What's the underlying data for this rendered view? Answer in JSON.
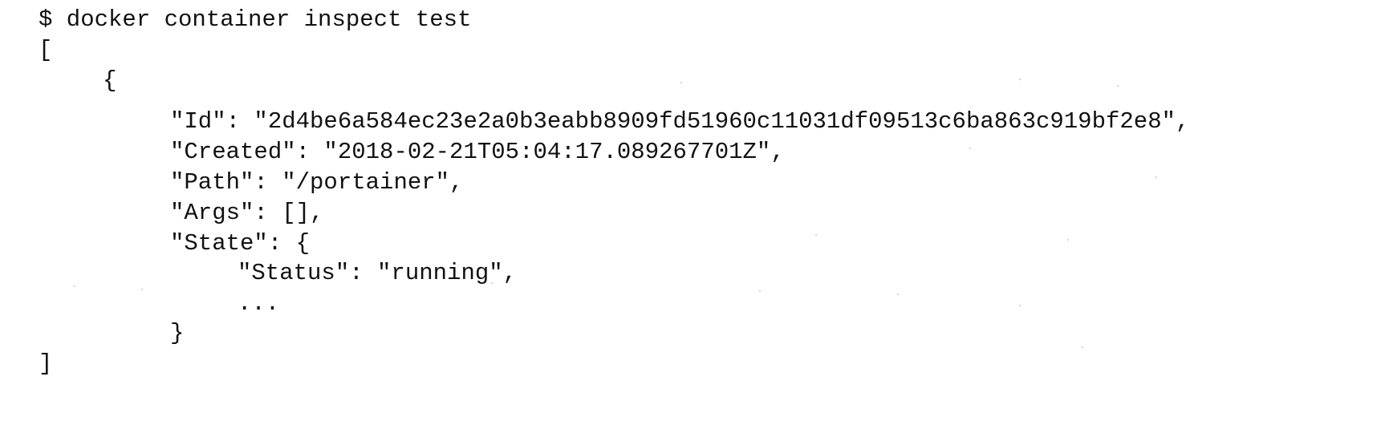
{
  "terminal": {
    "lines": [
      "$ docker container inspect test",
      "[",
      "{",
      "\"Id\": \"2d4be6a584ec23e2a0b3eabb8909fd51960c11031df09513c6ba863c919bf2e8\",",
      "\"Created\": \"2018-02-21T05:04:17.089267701Z\",",
      "\"Path\": \"/portainer\",",
      "\"Args\": [],",
      "\"State\": {",
      "\"Status\": \"running\",",
      "...",
      "}",
      "]"
    ]
  },
  "colors": {
    "background": "#ffffff",
    "text": "#111111"
  }
}
